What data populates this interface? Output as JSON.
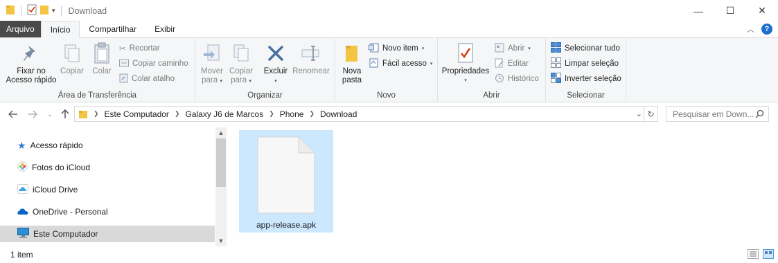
{
  "window": {
    "title": "Download",
    "controls": {
      "minimize": "—",
      "maximize": "☐",
      "close": "✕"
    }
  },
  "ribbon_tabs": [
    "Arquivo",
    "Início",
    "Compartilhar",
    "Exibir"
  ],
  "help_label": "?",
  "ribbon": {
    "clipboard": {
      "label": "Área de Transferência",
      "pin": [
        "Fixar no",
        "Acesso rápido"
      ],
      "copy": "Copiar",
      "paste": "Colar",
      "cut": "Recortar",
      "copy_path": "Copiar caminho",
      "paste_shortcut": "Colar atalho"
    },
    "organize": {
      "label": "Organizar",
      "move_to": [
        "Mover",
        "para"
      ],
      "copy_to": [
        "Copiar",
        "para"
      ],
      "delete": "Excluir",
      "rename": "Renomear"
    },
    "new": {
      "label": "Novo",
      "new_folder": [
        "Nova",
        "pasta"
      ],
      "new_item": "Novo item",
      "easy_access": "Fácil acesso"
    },
    "open": {
      "label": "Abrir",
      "properties": "Propriedades",
      "open": "Abrir",
      "edit": "Editar",
      "history": "Histórico"
    },
    "select": {
      "label": "Selecionar",
      "select_all": "Selecionar tudo",
      "select_none": "Limpar seleção",
      "invert": "Inverter seleção"
    }
  },
  "breadcrumb": [
    "Este Computador",
    "Galaxy J6 de Marcos",
    "Phone",
    "Download"
  ],
  "search": {
    "placeholder": "Pesquisar em Down..."
  },
  "nav_items": [
    {
      "label": "Acesso rápido",
      "icon": "star-icon",
      "color": "#2b7cd3"
    },
    {
      "label": "Fotos do iCloud",
      "icon": "photos-icon",
      "color": "#f0a030"
    },
    {
      "label": "iCloud Drive",
      "icon": "cloud-icon",
      "color": "#3aa0e8"
    },
    {
      "label": "OneDrive - Personal",
      "icon": "onedrive-icon",
      "color": "#0a64c8"
    },
    {
      "label": "Este Computador",
      "icon": "computer-icon",
      "color": "#2b8fd6",
      "selected": true
    }
  ],
  "files": [
    {
      "name": "app-release.apk",
      "icon": "file-icon",
      "selected": true
    }
  ],
  "status": {
    "count": "1 item"
  },
  "colors": {
    "accent": "#1e6fd0",
    "selection": "#cce8ff",
    "folder": "#f4c542"
  }
}
